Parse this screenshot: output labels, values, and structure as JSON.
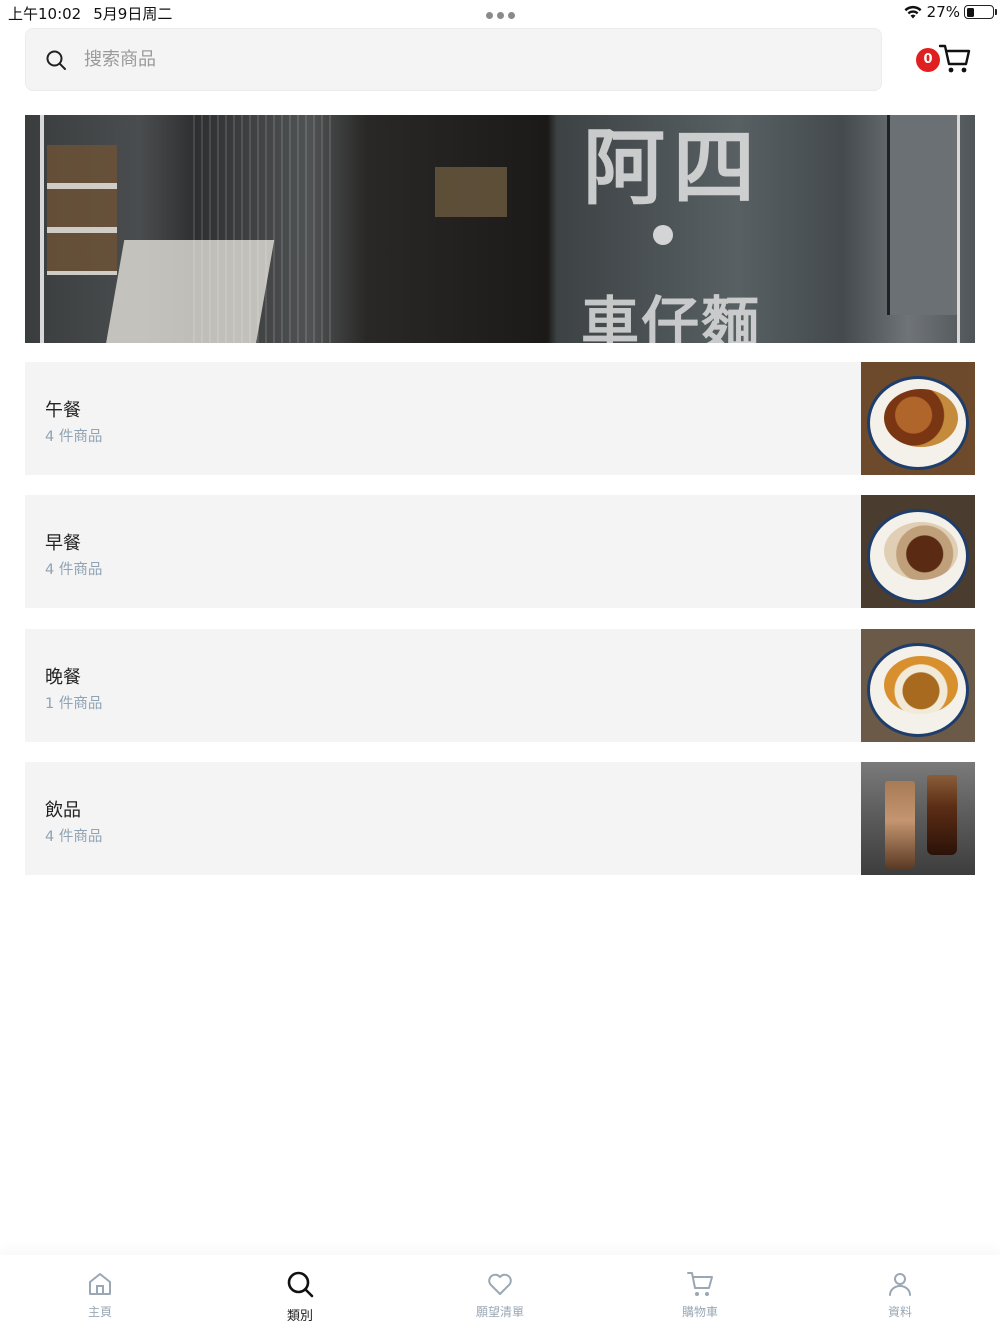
{
  "status_bar": {
    "time": "上午10:02",
    "date": "5月9日周二",
    "battery_percent": "27%",
    "battery_level": 0.27
  },
  "header": {
    "search_placeholder": "搜索商品",
    "cart_count": "0",
    "icons": [
      "search-icon",
      "cart-icon"
    ]
  },
  "banner": {
    "sign_main": "阿四",
    "sign_sub": "車仔麵"
  },
  "categories": [
    {
      "name": "午餐",
      "count": "4 件商品"
    },
    {
      "name": "早餐",
      "count": "4 件商品"
    },
    {
      "name": "晚餐",
      "count": "1 件商品"
    },
    {
      "name": "飲品",
      "count": "4 件商品"
    }
  ],
  "tabs": [
    {
      "label": "主頁",
      "icon": "home-icon"
    },
    {
      "label": "類別",
      "icon": "search-icon",
      "active": true
    },
    {
      "label": "願望清單",
      "icon": "heart-icon"
    },
    {
      "label": "購物車",
      "icon": "cart-icon"
    },
    {
      "label": "資料",
      "icon": "user-icon"
    }
  ],
  "colors": {
    "badge": "#e02020",
    "card_bg": "#f4f4f4",
    "muted_text": "#8fa3b5",
    "tab_inactive": "#9aa8b5"
  }
}
